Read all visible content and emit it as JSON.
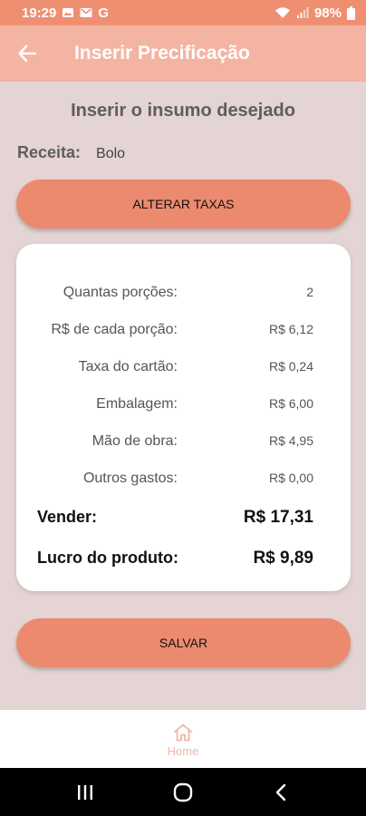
{
  "status_bar": {
    "time": "19:29",
    "battery": "98%"
  },
  "app_bar": {
    "title": "Inserir Precificação"
  },
  "subtitle": "Inserir o insumo desejado",
  "recipe": {
    "label": "Receita:",
    "value": "Bolo"
  },
  "buttons": {
    "alter_taxes": "ALTERAR TAXAS",
    "save": "SALVAR"
  },
  "card": {
    "rows": [
      {
        "label": "Quantas porções:",
        "value": "2"
      },
      {
        "label": "R$ de cada porção:",
        "value": "R$ 6,12"
      },
      {
        "label": "Taxa do cartão:",
        "value": "R$ 0,24"
      },
      {
        "label": "Embalagem:",
        "value": "R$ 6,00"
      },
      {
        "label": "Mão de obra:",
        "value": "R$ 4,95"
      },
      {
        "label": "Outros gastos:",
        "value": "R$ 0,00"
      }
    ],
    "sell": {
      "label": "Vender:",
      "value": "R$ 17,31"
    },
    "profit": {
      "label": "Lucro do produto:",
      "value": "R$ 9,89"
    }
  },
  "bottom_nav": {
    "home_label": "Home"
  },
  "colors": {
    "primary": "#ec8a6f",
    "app_bar": "#f3b4a2",
    "status_bar": "#ef8f72",
    "background": "#e4d4d3",
    "home_inactive": "#f0b6a6"
  },
  "icons": [
    "back-arrow-icon",
    "home-icon",
    "wifi-icon",
    "signal-icon",
    "battery-icon",
    "recent-apps-icon",
    "home-circle-icon",
    "system-back-icon"
  ]
}
